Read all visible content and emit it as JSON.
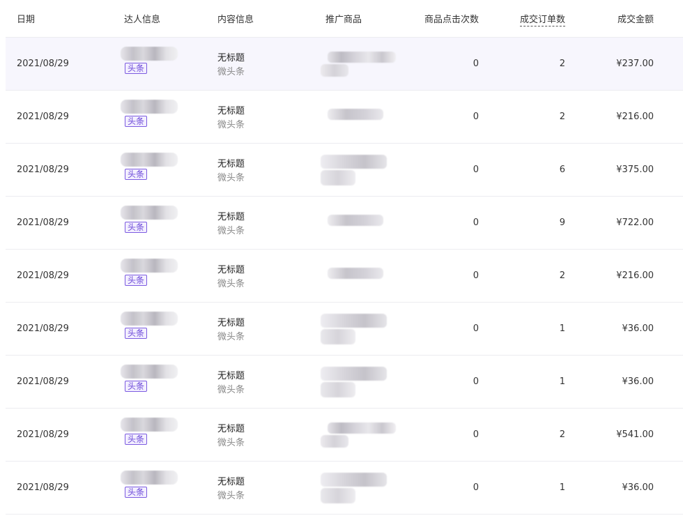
{
  "table": {
    "columns": {
      "date": "日期",
      "influencer": "达人信息",
      "content": "内容信息",
      "product": "推广商品",
      "clicks": "商品点击次数",
      "orders": "成交订单数",
      "amount": "成交金额"
    },
    "rows": [
      {
        "date": "2021/08/29",
        "platform_tag": "头条",
        "content_title": "无标题",
        "content_source": "微头条",
        "clicks": "0",
        "orders": "2",
        "amount": "¥237.00"
      },
      {
        "date": "2021/08/29",
        "platform_tag": "头条",
        "content_title": "无标题",
        "content_source": "微头条",
        "clicks": "0",
        "orders": "2",
        "amount": "¥216.00"
      },
      {
        "date": "2021/08/29",
        "platform_tag": "头条",
        "content_title": "无标题",
        "content_source": "微头条",
        "clicks": "0",
        "orders": "6",
        "amount": "¥375.00"
      },
      {
        "date": "2021/08/29",
        "platform_tag": "头条",
        "content_title": "无标题",
        "content_source": "微头条",
        "clicks": "0",
        "orders": "9",
        "amount": "¥722.00"
      },
      {
        "date": "2021/08/29",
        "platform_tag": "头条",
        "content_title": "无标题",
        "content_source": "微头条",
        "clicks": "0",
        "orders": "2",
        "amount": "¥216.00"
      },
      {
        "date": "2021/08/29",
        "platform_tag": "头条",
        "content_title": "无标题",
        "content_source": "微头条",
        "clicks": "0",
        "orders": "1",
        "amount": "¥36.00"
      },
      {
        "date": "2021/08/29",
        "platform_tag": "头条",
        "content_title": "无标题",
        "content_source": "微头条",
        "clicks": "0",
        "orders": "1",
        "amount": "¥36.00"
      },
      {
        "date": "2021/08/29",
        "platform_tag": "头条",
        "content_title": "无标题",
        "content_source": "微头条",
        "clicks": "0",
        "orders": "2",
        "amount": "¥541.00"
      },
      {
        "date": "2021/08/29",
        "platform_tag": "头条",
        "content_title": "无标题",
        "content_source": "微头条",
        "clicks": "0",
        "orders": "1",
        "amount": "¥36.00"
      }
    ]
  },
  "colors": {
    "accent": "#6b48d8",
    "row_highlight": "#f7f6fd"
  }
}
